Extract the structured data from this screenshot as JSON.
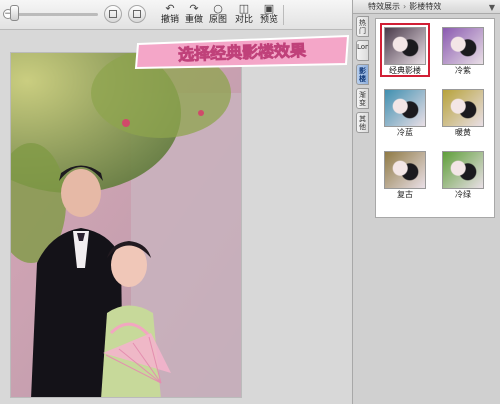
{
  "toolbar": {
    "zoom_minus": "−",
    "tools": [
      {
        "icon": "undo-icon",
        "glyph": "↶",
        "label": "撤销"
      },
      {
        "icon": "redo-icon",
        "glyph": "↷",
        "label": "重做"
      },
      {
        "icon": "original-icon",
        "glyph": "○",
        "label": "原图"
      },
      {
        "icon": "compare-icon",
        "glyph": "◫",
        "label": "对比"
      },
      {
        "icon": "preview-icon",
        "glyph": "▣",
        "label": "预览"
      }
    ]
  },
  "banner": {
    "text": "选择经典影楼效果"
  },
  "panel": {
    "breadcrumb": [
      "特效展示",
      "影楼特效"
    ],
    "vertical_tabs": [
      "热门",
      "Lomo",
      "影楼",
      "渐变",
      "其他"
    ],
    "active_tab_index": 2,
    "effects": [
      {
        "label": "经典影楼",
        "tint": "#4a3a4a",
        "selected": true
      },
      {
        "label": "冷紫",
        "tint": "#8a5ab0",
        "selected": false
      },
      {
        "label": "冷蓝",
        "tint": "#3f8fb0",
        "selected": false
      },
      {
        "label": "暖黄",
        "tint": "#b7a23a",
        "selected": false
      },
      {
        "label": "复古",
        "tint": "#8f7a44",
        "selected": false
      },
      {
        "label": "冷绿",
        "tint": "#5f9f3a",
        "selected": false
      }
    ]
  },
  "colors": {
    "selection_border": "#d11f35",
    "banner_pink": "#f4a6c8",
    "active_tab": "#8eaedb"
  }
}
